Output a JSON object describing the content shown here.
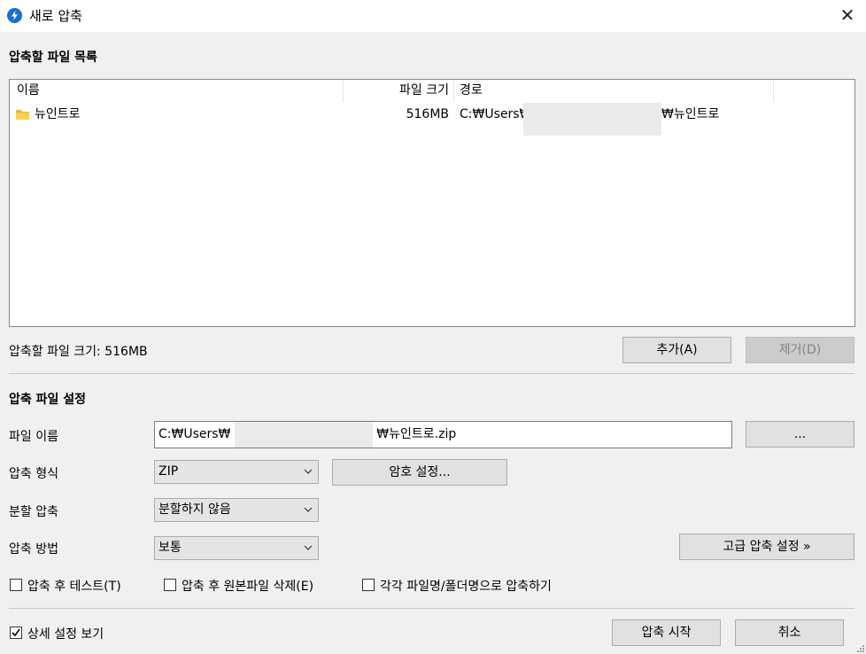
{
  "window": {
    "title": "새로 압축",
    "close_glyph": "✕",
    "app_icon": "bandizip-logo-icon",
    "accent": "#1a6fd1"
  },
  "file_list": {
    "section_title": "압축할 파일 목록",
    "columns": {
      "name": "이름",
      "size": "파일 크기",
      "path": "경로"
    },
    "rows": [
      {
        "icon": "folder-icon",
        "name": "뉴인트로",
        "size": "516MB",
        "path_prefix": "C:₩Users₩",
        "path_suffix": "₩뉴인트로"
      }
    ],
    "total_size_label": "압축할 파일 크기: 516MB",
    "add_button": "추가(A)",
    "remove_button": "제거(D)"
  },
  "settings": {
    "section_title": "압축 파일 설정",
    "filename_label": "파일 이름",
    "filename_prefix": "C:₩Users₩",
    "filename_suffix": "₩뉴인트로.zip",
    "browse_button": "...",
    "format_label": "압축 형식",
    "format_value": "ZIP",
    "password_button": "암호 설정...",
    "split_label": "분할 압축",
    "split_value": "분할하지 않음",
    "method_label": "압축 방법",
    "method_value": "보통",
    "advanced_button": "고급 압축 설정 »",
    "checkboxes": {
      "test_after": {
        "label": "압축 후 테스트(T)",
        "checked": false
      },
      "delete_source": {
        "label": "압축 후 원본파일 삭제(E)",
        "checked": false
      },
      "each_separately": {
        "label": "각각 파일명/폴더명으로 압축하기",
        "checked": false
      }
    }
  },
  "footer": {
    "show_details": {
      "label": "상세 설정 보기",
      "checked": true
    },
    "start_button": "압축 시작",
    "cancel_button": "취소"
  }
}
